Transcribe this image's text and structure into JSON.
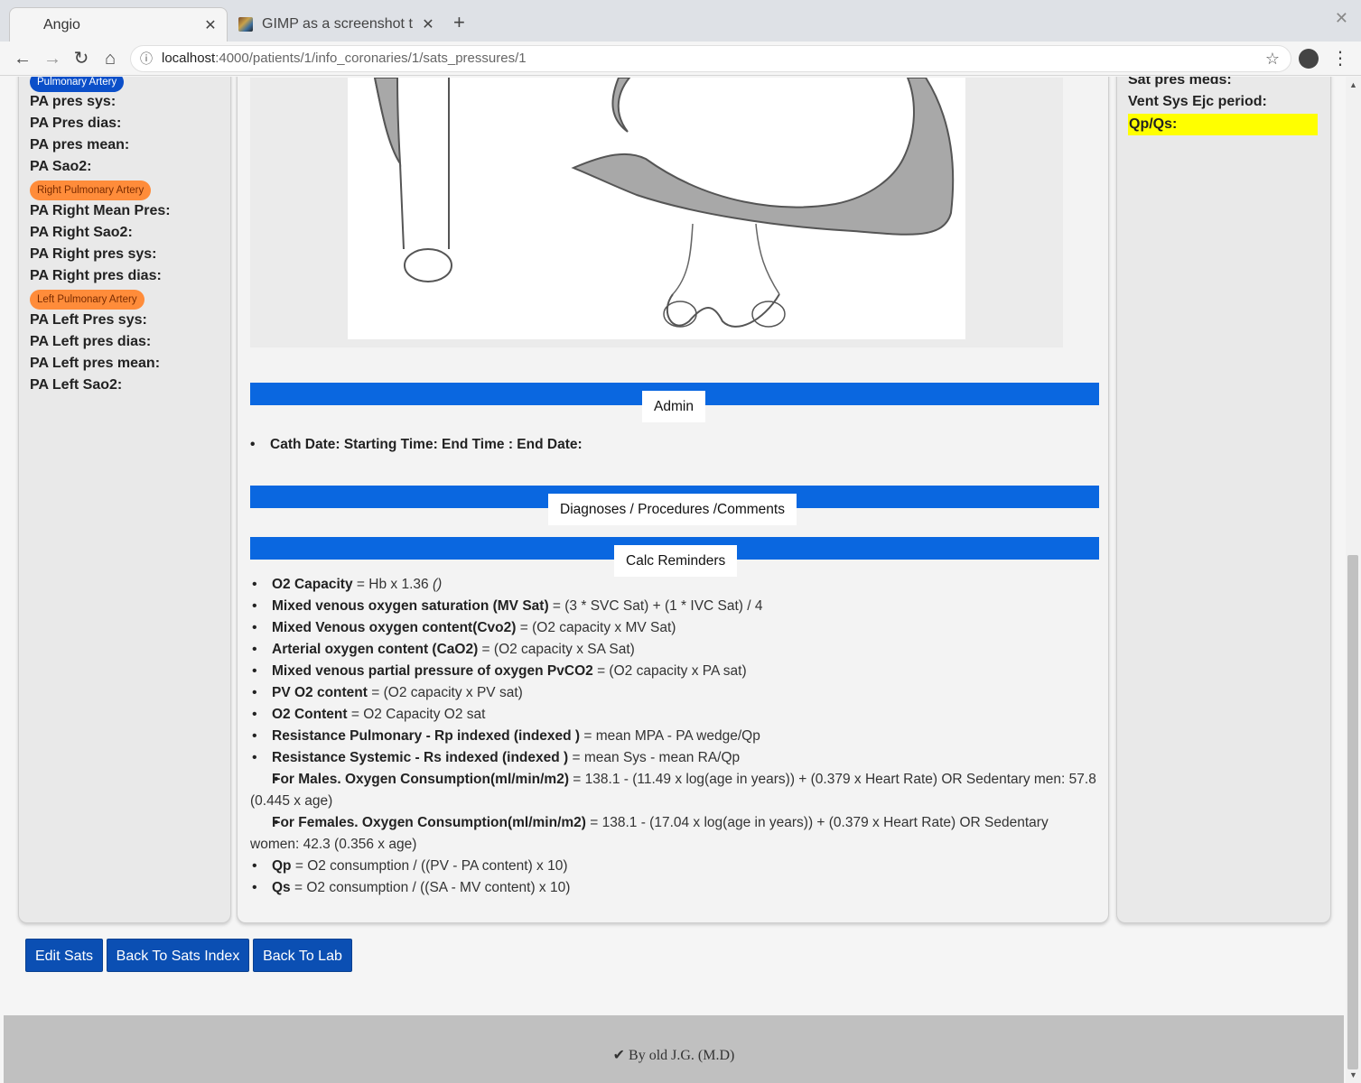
{
  "browser": {
    "tabs": [
      {
        "title": "Angio",
        "active": true
      },
      {
        "title": "GIMP as a screenshot t",
        "active": false
      }
    ],
    "url_host": "localhost",
    "url_path": ":4000/patients/1/info_coronaries/1/sats_pressures/1"
  },
  "left_panel": {
    "badge_pa": "Pulmonary Artery",
    "pa_fields": [
      "PA pres sys:",
      "PA Pres dias:",
      "PA pres mean:",
      "PA Sao2:"
    ],
    "badge_rpa": "Right Pulmonary Artery",
    "rpa_fields": [
      "PA Right Mean Pres:",
      "PA Right Sao2:",
      "PA Right pres sys:",
      "PA Right pres dias:"
    ],
    "badge_lpa": "Left Pulmonary Artery",
    "lpa_fields": [
      "PA Left Pres sys:",
      "PA Left pres dias:",
      "PA Left pres mean:",
      "PA Left Sao2:"
    ]
  },
  "right_panel": {
    "fields": [
      "Sat pres meds:",
      "Vent Sys Ejc period:",
      "Qp/Qs:"
    ]
  },
  "main": {
    "admin_title": "Admin",
    "admin_line": "Cath Date: Starting Time: End Time : End Date:",
    "diag_title": "Diagnoses / Procedures /Comments",
    "calc_title": "Calc Reminders",
    "calc_items": [
      {
        "term": "O2 Capacity",
        "formula": " = Hb x 1.36 ",
        "note": "()"
      },
      {
        "term": "Mixed venous oxygen saturation (MV Sat)",
        "formula": " = (3 * SVC Sat) + (1 * IVC Sat) / 4"
      },
      {
        "term": "Mixed Venous oxygen content(Cvo2)",
        "formula": " = (O2 capacity x MV Sat)"
      },
      {
        "term": "Arterial oxygen content (CaO2)",
        "formula": " = (O2 capacity x SA Sat)"
      },
      {
        "term": "Mixed venous partial pressure of oxygen PvCO2",
        "formula": " = (O2 capacity x PA sat)"
      },
      {
        "term": "PV O2 content",
        "formula": " = (O2 capacity x PV sat)"
      },
      {
        "term": "O2 Content",
        "formula": " = O2 Capacity O2 sat"
      },
      {
        "term": "Resistance Pulmonary - Rp indexed (indexed )",
        "formula": " = mean MPA - PA wedge/Qp"
      },
      {
        "term": "Resistance Systemic - Rs indexed (indexed )",
        "formula": " = mean Sys - mean RA/Qp"
      },
      {
        "term": "For Males. Oxygen Consumption(ml/min/m2)",
        "formula": " = 138.1 - (11.49 x log(age in years)) + (0.379 x Heart Rate) OR Sedentary men: 57.8 (0.445 x age)"
      },
      {
        "term": "For Females. Oxygen Consumption(ml/min/m2)",
        "formula": " = 138.1 - (17.04 x log(age in years)) + (0.379 x Heart Rate) OR Sedentary women: 42.3 (0.356 x age)"
      },
      {
        "term": "Qp",
        "formula": " = O2 consumption / ((PV - PA content) x 10)"
      },
      {
        "term": "Qs",
        "formula": " = O2 consumption / ((SA - MV content) x 10)"
      }
    ]
  },
  "buttons": {
    "edit_sats": "Edit Sats",
    "back_sats_index": "Back To Sats Index",
    "back_lab": "Back To Lab"
  },
  "footer": {
    "signature": "By old J.G. (M.D)"
  },
  "colors": {
    "band": "#0a67e0",
    "button": "#0b4fb3",
    "badge_blue": "#0b4fc9",
    "badge_orange": "#ff8c3a",
    "highlight": "#ffff00"
  }
}
